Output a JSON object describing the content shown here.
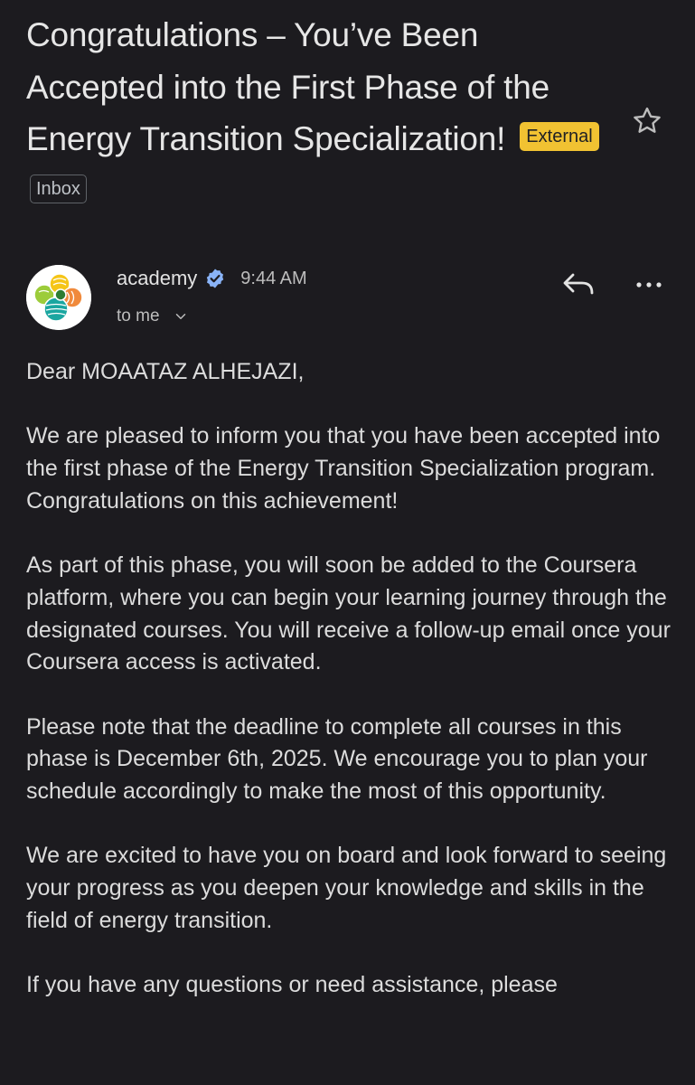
{
  "email": {
    "subject": "Congratulations – You’ve Been Accepted into the First Phase of the Energy Transition Specialization!",
    "labels": {
      "external": "External",
      "inbox": "Inbox"
    },
    "sender": {
      "name": "academy",
      "time": "9:44 AM",
      "recipient": "to me"
    },
    "body": {
      "greeting": "Dear MOAATAZ ALHEJAZI,",
      "p1": "We are pleased to inform you that you have been accepted into the first phase of the Energy Transition Specialization program. Congratulations on this achievement!",
      "p2": "As part of this phase, you will soon be added to the Coursera platform, where you can begin your learning journey through the designated courses. You will receive a follow-up email once your Coursera access is activated.",
      "p3": "Please note that the deadline to complete all courses in this phase is December 6th, 2025. We encourage you to plan your schedule accordingly to make the most of this opportunity.",
      "p4": "We are excited to have you on board and look forward to seeing your progress as you deepen your knowledge and skills in the field of energy transition.",
      "p5": "If you have any questions or need assistance, please"
    }
  },
  "icons": {
    "star": "star-outline-icon",
    "verified": "verified-badge-icon",
    "expand": "chevron-down-icon",
    "reply": "reply-icon",
    "more": "more-horizontal-icon",
    "avatar": "sender-logo"
  },
  "colors": {
    "background": "#1c1b1f",
    "text": "#e3e3e3",
    "external_badge": "#f1c232",
    "verified": "#8ab4f8"
  }
}
